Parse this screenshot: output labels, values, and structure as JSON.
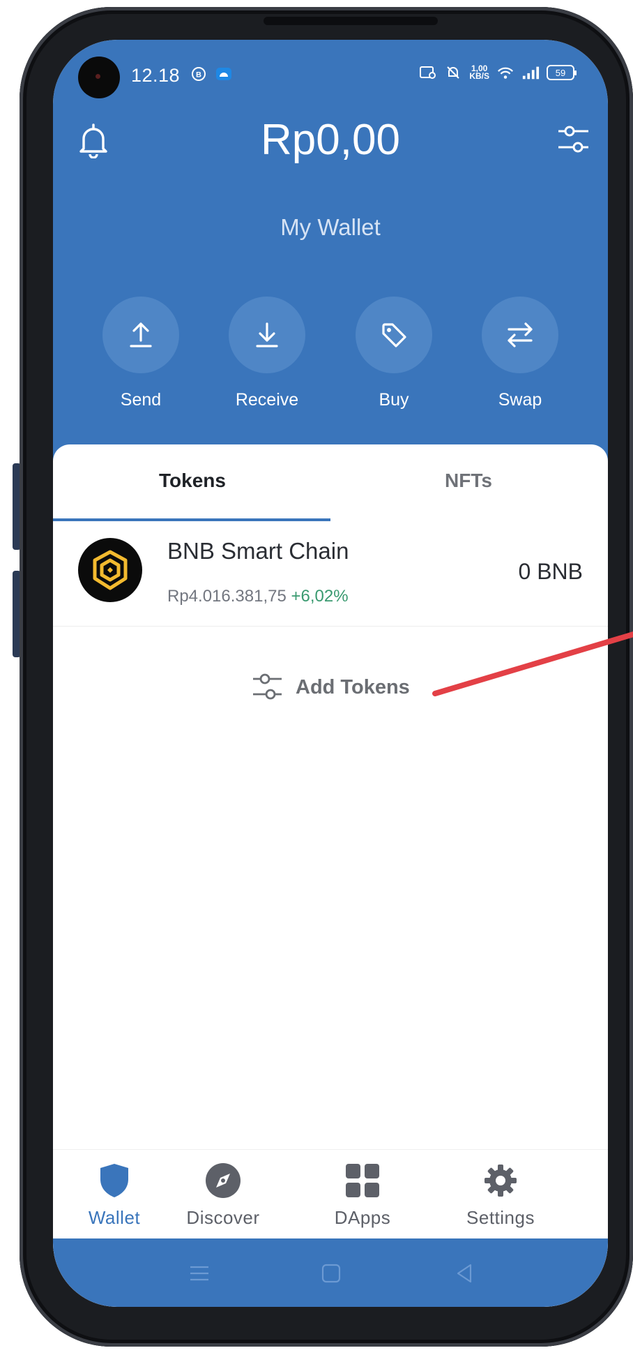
{
  "status_bar": {
    "time": "12.18",
    "net_speed_value": "1,00",
    "net_speed_unit": "KB/S",
    "battery": "59",
    "icons": [
      "whatsapp-business-icon",
      "android-icon",
      "screen-record-icon",
      "mute-bell-icon",
      "wifi-icon",
      "signal-icon",
      "battery-icon"
    ]
  },
  "header": {
    "balance": "Rp0,00",
    "wallet_name": "My Wallet",
    "notifications_icon": "bell-icon",
    "manage_icon": "filter-sliders-icon"
  },
  "actions": [
    {
      "label": "Send",
      "icon": "arrow-up-icon"
    },
    {
      "label": "Receive",
      "icon": "arrow-down-icon"
    },
    {
      "label": "Buy",
      "icon": "tag-icon"
    },
    {
      "label": "Swap",
      "icon": "swap-arrows-icon"
    }
  ],
  "tabs": [
    {
      "label": "Tokens",
      "active": true
    },
    {
      "label": "NFTs",
      "active": false
    }
  ],
  "tokens": [
    {
      "name": "BNB Smart Chain",
      "price": "Rp4.016.381,75",
      "change": "+6,02%",
      "balance": "0 BNB",
      "icon": "bnb-logo-icon"
    }
  ],
  "add_tokens": {
    "label": "Add Tokens",
    "icon": "filter-sliders-icon"
  },
  "bottom_nav": [
    {
      "label": "Wallet",
      "icon": "shield-icon",
      "active": true
    },
    {
      "label": "Discover",
      "icon": "compass-icon",
      "active": false
    },
    {
      "label": "DApps",
      "icon": "grid-icon",
      "active": false
    },
    {
      "label": "Settings",
      "icon": "gear-icon",
      "active": false
    }
  ],
  "colors": {
    "brand_blue": "#3a75bb",
    "positive_green": "#3a9a70",
    "annotation_red": "#e34046",
    "bnb_yellow": "#f3ba2f"
  }
}
